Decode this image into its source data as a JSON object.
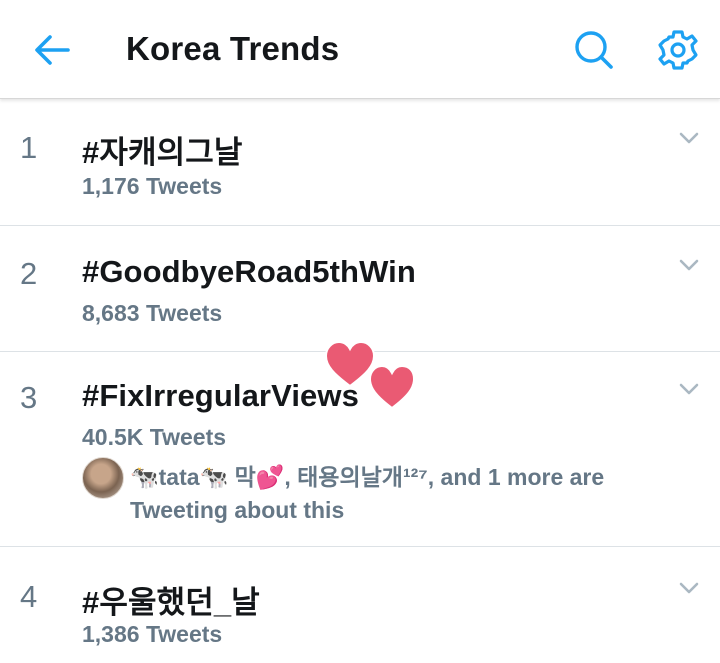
{
  "header": {
    "title": "Korea Trends",
    "back_icon": "arrow-left-icon",
    "search_icon": "search-icon",
    "settings_icon": "gear-icon",
    "accent_color": "#1da1f2"
  },
  "trends": [
    {
      "rank": "1",
      "name": "#자캐의그날",
      "count": "1,176 Tweets"
    },
    {
      "rank": "2",
      "name": "#GoodbyeRoad5thWin",
      "count": "8,683 Tweets"
    },
    {
      "rank": "3",
      "name": "#FixIrregularViews",
      "count": "40.5K Tweets",
      "social": {
        "line1": "🐄tata🐄 막💕, 태용의날개¹²⁷, and 1 more are",
        "line2": "Tweeting about this"
      }
    },
    {
      "rank": "4",
      "name": "#우울했던_날",
      "count": "1,386 Tweets"
    }
  ],
  "colors": {
    "text": "#14171a",
    "secondary": "#657786",
    "divider": "#dde2e6",
    "heart": "#e8556d"
  }
}
